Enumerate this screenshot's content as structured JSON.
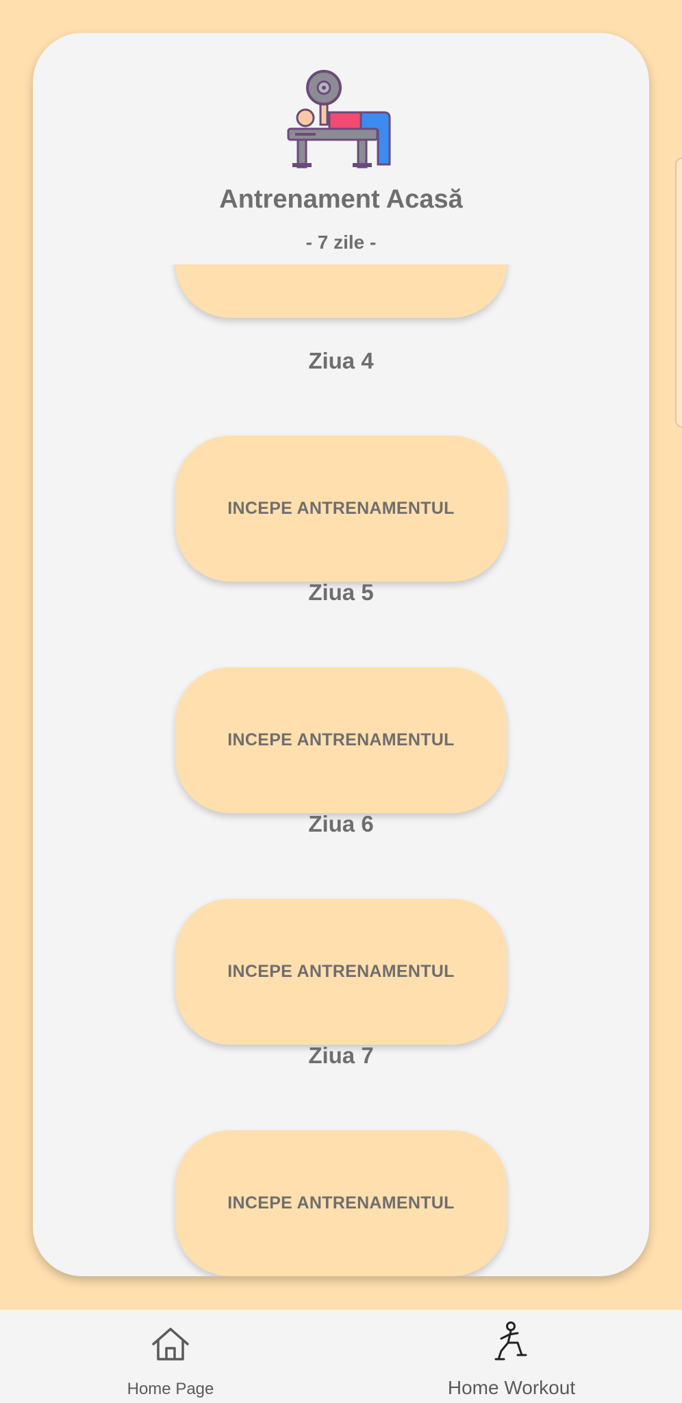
{
  "header": {
    "title": "Antrenament Acasă",
    "subtitle": "- 7 zile -",
    "icon": "bench-press-icon"
  },
  "days": [
    {
      "label": "Ziua 4",
      "button_label": "INCEPE ANTRENAMENTUL"
    },
    {
      "label": "Ziua 5",
      "button_label": "INCEPE ANTRENAMENTUL"
    },
    {
      "label": "Ziua 6",
      "button_label": "INCEPE ANTRENAMENTUL"
    },
    {
      "label": "Ziua 7",
      "button_label": "INCEPE ANTRENAMENTUL"
    }
  ],
  "bottom_nav": {
    "items": [
      {
        "label": "Home Page",
        "icon": "home-icon"
      },
      {
        "label": "Home Workout",
        "icon": "lunge-exercise-icon"
      }
    ]
  },
  "colors": {
    "background": "#FFDFAE",
    "card": "#F4F4F5",
    "text": "#6E6E6E",
    "button": "#FFDFAE"
  }
}
